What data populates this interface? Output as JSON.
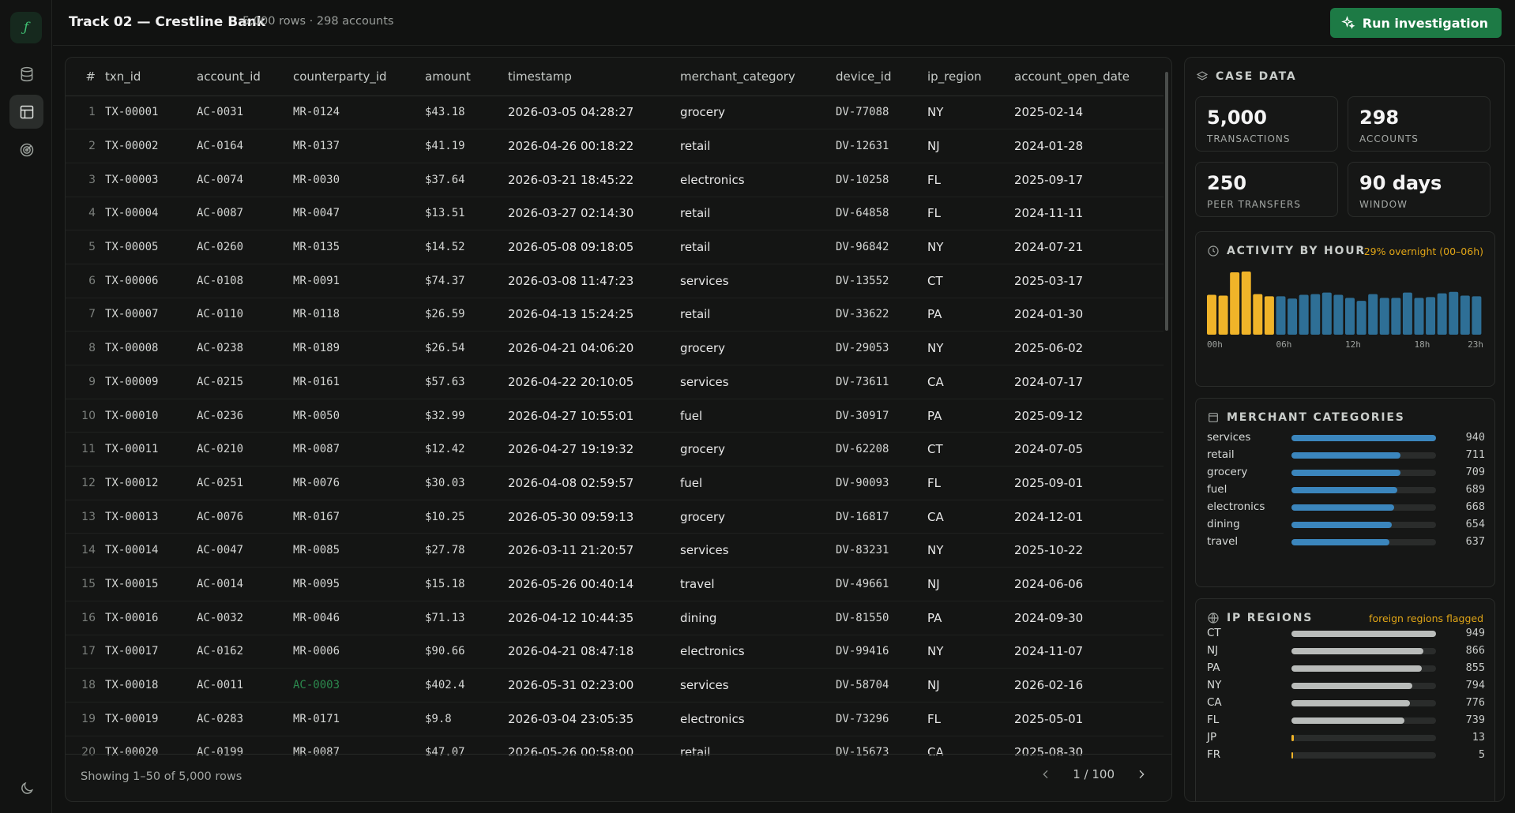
{
  "sidebar": {
    "logo": "ƒ",
    "items": [
      {
        "icon": "database-icon"
      },
      {
        "icon": "table-icon",
        "active": true
      },
      {
        "icon": "radar-icon"
      }
    ],
    "footer_icon": "moon-icon"
  },
  "header": {
    "title": "Track 02 — Crestline Bank",
    "subtitle": "5,000 rows · 298 accounts",
    "run_button": "Run investigation"
  },
  "table": {
    "columns": [
      "#",
      "txn_id",
      "account_id",
      "counterparty_id",
      "amount",
      "timestamp",
      "merchant_category",
      "device_id",
      "ip_region",
      "account_open_date"
    ],
    "rows": [
      [
        "1",
        "TX-00001",
        "AC-0031",
        "MR-0124",
        "$43.18",
        "2026-03-05 04:28:27",
        "grocery",
        "DV-77088",
        "NY",
        "2025-02-14"
      ],
      [
        "2",
        "TX-00002",
        "AC-0164",
        "MR-0137",
        "$41.19",
        "2026-04-26 00:18:22",
        "retail",
        "DV-12631",
        "NJ",
        "2024-01-28"
      ],
      [
        "3",
        "TX-00003",
        "AC-0074",
        "MR-0030",
        "$37.64",
        "2026-03-21 18:45:22",
        "electronics",
        "DV-10258",
        "FL",
        "2025-09-17"
      ],
      [
        "4",
        "TX-00004",
        "AC-0087",
        "MR-0047",
        "$13.51",
        "2026-03-27 02:14:30",
        "retail",
        "DV-64858",
        "FL",
        "2024-11-11"
      ],
      [
        "5",
        "TX-00005",
        "AC-0260",
        "MR-0135",
        "$14.52",
        "2026-05-08 09:18:05",
        "retail",
        "DV-96842",
        "NY",
        "2024-07-21"
      ],
      [
        "6",
        "TX-00006",
        "AC-0108",
        "MR-0091",
        "$74.37",
        "2026-03-08 11:47:23",
        "services",
        "DV-13552",
        "CT",
        "2025-03-17"
      ],
      [
        "7",
        "TX-00007",
        "AC-0110",
        "MR-0118",
        "$26.59",
        "2026-04-13 15:24:25",
        "retail",
        "DV-33622",
        "PA",
        "2024-01-30"
      ],
      [
        "8",
        "TX-00008",
        "AC-0238",
        "MR-0189",
        "$26.54",
        "2026-04-21 04:06:20",
        "grocery",
        "DV-29053",
        "NY",
        "2025-06-02"
      ],
      [
        "9",
        "TX-00009",
        "AC-0215",
        "MR-0161",
        "$57.63",
        "2026-04-22 20:10:05",
        "services",
        "DV-73611",
        "CA",
        "2024-07-17"
      ],
      [
        "10",
        "TX-00010",
        "AC-0236",
        "MR-0050",
        "$32.99",
        "2026-04-27 10:55:01",
        "fuel",
        "DV-30917",
        "PA",
        "2025-09-12"
      ],
      [
        "11",
        "TX-00011",
        "AC-0210",
        "MR-0087",
        "$12.42",
        "2026-04-27 19:19:32",
        "grocery",
        "DV-62208",
        "CT",
        "2024-07-05"
      ],
      [
        "12",
        "TX-00012",
        "AC-0251",
        "MR-0076",
        "$30.03",
        "2026-04-08 02:59:57",
        "fuel",
        "DV-90093",
        "FL",
        "2025-09-01"
      ],
      [
        "13",
        "TX-00013",
        "AC-0076",
        "MR-0167",
        "$10.25",
        "2026-05-30 09:59:13",
        "grocery",
        "DV-16817",
        "CA",
        "2024-12-01"
      ],
      [
        "14",
        "TX-00014",
        "AC-0047",
        "MR-0085",
        "$27.78",
        "2026-03-11 21:20:57",
        "services",
        "DV-83231",
        "NY",
        "2025-10-22"
      ],
      [
        "15",
        "TX-00015",
        "AC-0014",
        "MR-0095",
        "$15.18",
        "2026-05-26 00:40:14",
        "travel",
        "DV-49661",
        "NJ",
        "2024-06-06"
      ],
      [
        "16",
        "TX-00016",
        "AC-0032",
        "MR-0046",
        "$71.13",
        "2026-04-12 10:44:35",
        "dining",
        "DV-81550",
        "PA",
        "2024-09-30"
      ],
      [
        "17",
        "TX-00017",
        "AC-0162",
        "MR-0006",
        "$90.66",
        "2026-04-21 08:47:18",
        "electronics",
        "DV-99416",
        "NY",
        "2024-11-07"
      ],
      [
        "18",
        "TX-00018",
        "AC-0011",
        "AC-0003",
        "$402.4",
        "2026-05-31 02:23:00",
        "services",
        "DV-58704",
        "NJ",
        "2026-02-16"
      ],
      [
        "19",
        "TX-00019",
        "AC-0283",
        "MR-0171",
        "$9.8",
        "2026-03-04 23:05:35",
        "electronics",
        "DV-73296",
        "FL",
        "2025-05-01"
      ],
      [
        "20",
        "TX-00020",
        "AC-0199",
        "MR-0087",
        "$47.07",
        "2026-05-26 00:58:00",
        "retail",
        "DV-15673",
        "CA",
        "2025-08-30"
      ]
    ],
    "highlight_color": "#2c8a4e",
    "footer": "Showing 1–50 of 5,000 rows",
    "pager": "1 / 100"
  },
  "case_data": {
    "title": "CASE DATA",
    "stats": [
      {
        "value": "5,000",
        "label": "TRANSACTIONS"
      },
      {
        "value": "298",
        "label": "ACCOUNTS"
      },
      {
        "value": "250",
        "label": "PEER TRANSFERS"
      },
      {
        "value": "90 days",
        "label": "WINDOW"
      }
    ]
  },
  "activity": {
    "title": "ACTIVITY BY HOUR",
    "note": "29% overnight (00–06h)",
    "chart_data": {
      "type": "bar",
      "x": [
        0,
        1,
        2,
        3,
        4,
        5,
        6,
        7,
        8,
        9,
        10,
        11,
        12,
        13,
        14,
        15,
        16,
        17,
        18,
        19,
        20,
        21,
        22,
        23
      ],
      "values": [
        5.3,
        5.2,
        8.3,
        8.4,
        5.4,
        5.1,
        5.1,
        4.8,
        5.3,
        5.4,
        5.6,
        5.3,
        4.9,
        4.5,
        5.4,
        4.9,
        4.9,
        5.6,
        4.9,
        5.0,
        5.5,
        5.7,
        5.2,
        5.1
      ],
      "tick_labels": [
        "00h",
        "06h",
        "12h",
        "18h",
        "23h"
      ],
      "overnight_color": "#f0b429",
      "day_color": "#2e6f96"
    }
  },
  "merchant": {
    "title": "MERCHANT CATEGORIES",
    "color": "#3b86bd",
    "max": 940,
    "items": [
      {
        "label": "services",
        "value": 940
      },
      {
        "label": "retail",
        "value": 711
      },
      {
        "label": "grocery",
        "value": 709
      },
      {
        "label": "fuel",
        "value": 689
      },
      {
        "label": "electronics",
        "value": 668
      },
      {
        "label": "dining",
        "value": 654
      },
      {
        "label": "travel",
        "value": 637
      }
    ]
  },
  "regions": {
    "title": "IP REGIONS",
    "note": "foreign regions flagged",
    "color": "#b9bcba",
    "foreign_color": "#f0b429",
    "max": 949,
    "items": [
      {
        "label": "CT",
        "value": 949
      },
      {
        "label": "NJ",
        "value": 866
      },
      {
        "label": "PA",
        "value": 855
      },
      {
        "label": "NY",
        "value": 794
      },
      {
        "label": "CA",
        "value": 776
      },
      {
        "label": "FL",
        "value": 739
      },
      {
        "label": "JP",
        "value": 13,
        "foreign": true
      },
      {
        "label": "FR",
        "value": 5,
        "foreign": true
      }
    ]
  }
}
